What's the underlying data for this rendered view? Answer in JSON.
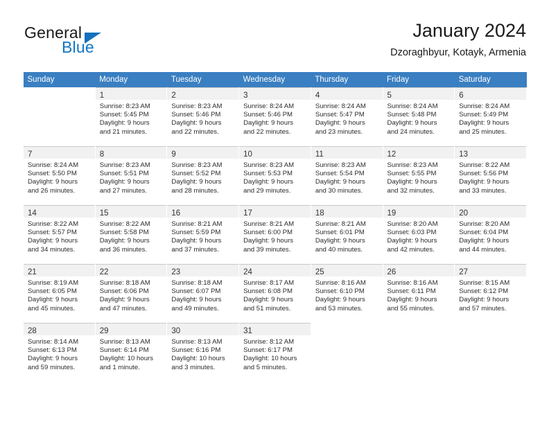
{
  "brand": {
    "name_top": "General",
    "name_bottom": "Blue",
    "accent_color": "#1470bd"
  },
  "header": {
    "title": "January 2024",
    "subtitle": "Dzoraghbyur, Kotayk, Armenia"
  },
  "calendar": {
    "header_bg": "#3a7fc1",
    "daynum_bg": "#f1f1f1",
    "weekdays": [
      "Sunday",
      "Monday",
      "Tuesday",
      "Wednesday",
      "Thursday",
      "Friday",
      "Saturday"
    ],
    "weeks": [
      [
        {
          "day": "",
          "empty": true
        },
        {
          "day": "1",
          "sunrise": "Sunrise: 8:23 AM",
          "sunset": "Sunset: 5:45 PM",
          "daylight1": "Daylight: 9 hours",
          "daylight2": "and 21 minutes."
        },
        {
          "day": "2",
          "sunrise": "Sunrise: 8:23 AM",
          "sunset": "Sunset: 5:46 PM",
          "daylight1": "Daylight: 9 hours",
          "daylight2": "and 22 minutes."
        },
        {
          "day": "3",
          "sunrise": "Sunrise: 8:24 AM",
          "sunset": "Sunset: 5:46 PM",
          "daylight1": "Daylight: 9 hours",
          "daylight2": "and 22 minutes."
        },
        {
          "day": "4",
          "sunrise": "Sunrise: 8:24 AM",
          "sunset": "Sunset: 5:47 PM",
          "daylight1": "Daylight: 9 hours",
          "daylight2": "and 23 minutes."
        },
        {
          "day": "5",
          "sunrise": "Sunrise: 8:24 AM",
          "sunset": "Sunset: 5:48 PM",
          "daylight1": "Daylight: 9 hours",
          "daylight2": "and 24 minutes."
        },
        {
          "day": "6",
          "sunrise": "Sunrise: 8:24 AM",
          "sunset": "Sunset: 5:49 PM",
          "daylight1": "Daylight: 9 hours",
          "daylight2": "and 25 minutes."
        }
      ],
      [
        {
          "day": "7",
          "sunrise": "Sunrise: 8:24 AM",
          "sunset": "Sunset: 5:50 PM",
          "daylight1": "Daylight: 9 hours",
          "daylight2": "and 26 minutes."
        },
        {
          "day": "8",
          "sunrise": "Sunrise: 8:23 AM",
          "sunset": "Sunset: 5:51 PM",
          "daylight1": "Daylight: 9 hours",
          "daylight2": "and 27 minutes."
        },
        {
          "day": "9",
          "sunrise": "Sunrise: 8:23 AM",
          "sunset": "Sunset: 5:52 PM",
          "daylight1": "Daylight: 9 hours",
          "daylight2": "and 28 minutes."
        },
        {
          "day": "10",
          "sunrise": "Sunrise: 8:23 AM",
          "sunset": "Sunset: 5:53 PM",
          "daylight1": "Daylight: 9 hours",
          "daylight2": "and 29 minutes."
        },
        {
          "day": "11",
          "sunrise": "Sunrise: 8:23 AM",
          "sunset": "Sunset: 5:54 PM",
          "daylight1": "Daylight: 9 hours",
          "daylight2": "and 30 minutes."
        },
        {
          "day": "12",
          "sunrise": "Sunrise: 8:23 AM",
          "sunset": "Sunset: 5:55 PM",
          "daylight1": "Daylight: 9 hours",
          "daylight2": "and 32 minutes."
        },
        {
          "day": "13",
          "sunrise": "Sunrise: 8:22 AM",
          "sunset": "Sunset: 5:56 PM",
          "daylight1": "Daylight: 9 hours",
          "daylight2": "and 33 minutes."
        }
      ],
      [
        {
          "day": "14",
          "sunrise": "Sunrise: 8:22 AM",
          "sunset": "Sunset: 5:57 PM",
          "daylight1": "Daylight: 9 hours",
          "daylight2": "and 34 minutes."
        },
        {
          "day": "15",
          "sunrise": "Sunrise: 8:22 AM",
          "sunset": "Sunset: 5:58 PM",
          "daylight1": "Daylight: 9 hours",
          "daylight2": "and 36 minutes."
        },
        {
          "day": "16",
          "sunrise": "Sunrise: 8:21 AM",
          "sunset": "Sunset: 5:59 PM",
          "daylight1": "Daylight: 9 hours",
          "daylight2": "and 37 minutes."
        },
        {
          "day": "17",
          "sunrise": "Sunrise: 8:21 AM",
          "sunset": "Sunset: 6:00 PM",
          "daylight1": "Daylight: 9 hours",
          "daylight2": "and 39 minutes."
        },
        {
          "day": "18",
          "sunrise": "Sunrise: 8:21 AM",
          "sunset": "Sunset: 6:01 PM",
          "daylight1": "Daylight: 9 hours",
          "daylight2": "and 40 minutes."
        },
        {
          "day": "19",
          "sunrise": "Sunrise: 8:20 AM",
          "sunset": "Sunset: 6:03 PM",
          "daylight1": "Daylight: 9 hours",
          "daylight2": "and 42 minutes."
        },
        {
          "day": "20",
          "sunrise": "Sunrise: 8:20 AM",
          "sunset": "Sunset: 6:04 PM",
          "daylight1": "Daylight: 9 hours",
          "daylight2": "and 44 minutes."
        }
      ],
      [
        {
          "day": "21",
          "sunrise": "Sunrise: 8:19 AM",
          "sunset": "Sunset: 6:05 PM",
          "daylight1": "Daylight: 9 hours",
          "daylight2": "and 45 minutes."
        },
        {
          "day": "22",
          "sunrise": "Sunrise: 8:18 AM",
          "sunset": "Sunset: 6:06 PM",
          "daylight1": "Daylight: 9 hours",
          "daylight2": "and 47 minutes."
        },
        {
          "day": "23",
          "sunrise": "Sunrise: 8:18 AM",
          "sunset": "Sunset: 6:07 PM",
          "daylight1": "Daylight: 9 hours",
          "daylight2": "and 49 minutes."
        },
        {
          "day": "24",
          "sunrise": "Sunrise: 8:17 AM",
          "sunset": "Sunset: 6:08 PM",
          "daylight1": "Daylight: 9 hours",
          "daylight2": "and 51 minutes."
        },
        {
          "day": "25",
          "sunrise": "Sunrise: 8:16 AM",
          "sunset": "Sunset: 6:10 PM",
          "daylight1": "Daylight: 9 hours",
          "daylight2": "and 53 minutes."
        },
        {
          "day": "26",
          "sunrise": "Sunrise: 8:16 AM",
          "sunset": "Sunset: 6:11 PM",
          "daylight1": "Daylight: 9 hours",
          "daylight2": "and 55 minutes."
        },
        {
          "day": "27",
          "sunrise": "Sunrise: 8:15 AM",
          "sunset": "Sunset: 6:12 PM",
          "daylight1": "Daylight: 9 hours",
          "daylight2": "and 57 minutes."
        }
      ],
      [
        {
          "day": "28",
          "sunrise": "Sunrise: 8:14 AM",
          "sunset": "Sunset: 6:13 PM",
          "daylight1": "Daylight: 9 hours",
          "daylight2": "and 59 minutes."
        },
        {
          "day": "29",
          "sunrise": "Sunrise: 8:13 AM",
          "sunset": "Sunset: 6:14 PM",
          "daylight1": "Daylight: 10 hours",
          "daylight2": "and 1 minute."
        },
        {
          "day": "30",
          "sunrise": "Sunrise: 8:13 AM",
          "sunset": "Sunset: 6:16 PM",
          "daylight1": "Daylight: 10 hours",
          "daylight2": "and 3 minutes."
        },
        {
          "day": "31",
          "sunrise": "Sunrise: 8:12 AM",
          "sunset": "Sunset: 6:17 PM",
          "daylight1": "Daylight: 10 hours",
          "daylight2": "and 5 minutes."
        },
        {
          "day": "",
          "empty": true
        },
        {
          "day": "",
          "empty": true
        },
        {
          "day": "",
          "empty": true
        }
      ]
    ]
  }
}
